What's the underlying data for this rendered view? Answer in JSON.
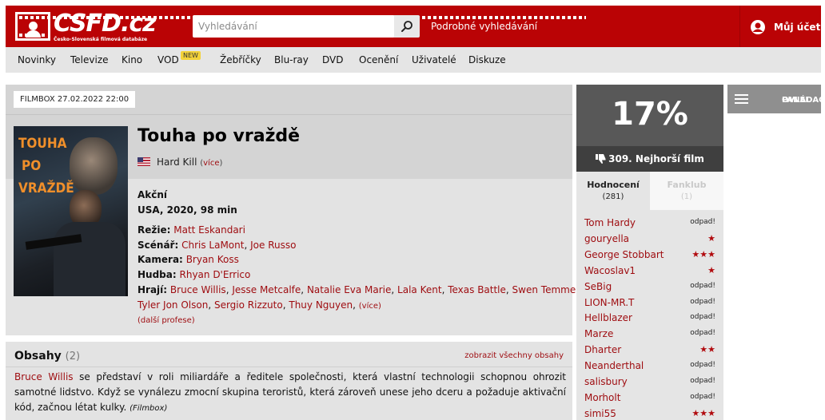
{
  "header": {
    "logo_text": "CSFD.cz",
    "logo_sub": "Česko-Slovenská filmová databáze",
    "search_placeholder": "Vyhledávání",
    "advanced_search": "Podrobné vyhledávání",
    "account": "Můj účet"
  },
  "nav": {
    "items": [
      "Novinky",
      "Televize",
      "Kino",
      "VOD",
      "Žebříčky",
      "Blu-ray",
      "DVD",
      "Ocenění",
      "Uživatelé",
      "Diskuze"
    ],
    "new_badge": "NEW"
  },
  "film": {
    "tv_chip": "FILMBOX 27.02.2022 22:00",
    "poster_text": [
      "TOUHA",
      "PO",
      "VRAŽDĚ"
    ],
    "title": "Touha po vraždě",
    "original_title": "Hard Kill",
    "original_more": "více",
    "genre": "Akční",
    "origin": "USA, 2020, 98 min",
    "directing_label": "Režie:",
    "directing": [
      "Matt Eskandari"
    ],
    "writing_label": "Scénář:",
    "writing": [
      "Chris LaMont",
      "Joe Russo"
    ],
    "camera_label": "Kamera:",
    "camera": [
      "Bryan Koss"
    ],
    "music_label": "Hudba:",
    "music": [
      "Rhyan D'Errico"
    ],
    "cast_label": "Hrají:",
    "cast_line1": [
      "Bruce Willis",
      "Jesse Metcalfe",
      "Natalie Eva Marie",
      "Lala Kent",
      "Texas Battle",
      "Swen Temmel"
    ],
    "cast_line2": [
      "Tyler Jon Olson",
      "Sergio Rizzuto",
      "Thuy Nguyen"
    ],
    "cast_more": "(více)",
    "more_professions": "(další profese)"
  },
  "plots": {
    "title": "Obsahy",
    "count": "(2)",
    "show_all": "zobrazit všechny obsahy",
    "text_link": "Bruce Willis",
    "text_1": " se představí v roli miliardáře a ředitele společnosti, která vlastní technologii schopnou ohrozit samotné lidstvo. Když se vynálezu zmocní skupina teroristů, která zároveň unese jeho dceru a požaduje aktivační kód, začnou létat kulky.",
    "source": "(Filmbox)"
  },
  "rating": {
    "percent": "17%",
    "rank": "309. Nejhorší film",
    "tab_active": "Hodnocení",
    "tab_active_count": "(281)",
    "tab_inactive": "Fanklub",
    "tab_inactive_count": "(1)",
    "users": [
      {
        "name": "Tom Hardy",
        "value": "odpad!",
        "stars": 0
      },
      {
        "name": "gouryella",
        "value": "",
        "stars": 1
      },
      {
        "name": "George Stobbart",
        "value": "",
        "stars": 3
      },
      {
        "name": "Wacoslav1",
        "value": "",
        "stars": 1
      },
      {
        "name": "SeBig",
        "value": "odpad!",
        "stars": 0
      },
      {
        "name": "LION-MR.T",
        "value": "odpad!",
        "stars": 0
      },
      {
        "name": "Hellblazer",
        "value": "odpad!",
        "stars": 0
      },
      {
        "name": "Marze",
        "value": "odpad!",
        "stars": 0
      },
      {
        "name": "Dharter",
        "value": "",
        "stars": 2
      },
      {
        "name": "Neanderthal",
        "value": "odpad!",
        "stars": 0
      },
      {
        "name": "salisbury",
        "value": "odpad!",
        "stars": 0
      },
      {
        "name": "Morholt",
        "value": "odpad!",
        "stars": 0
      },
      {
        "name": "simi55",
        "value": "",
        "stars": 3
      }
    ]
  },
  "panel": {
    "label_line1": "OVLÁDACÍ",
    "label_line2": "PANEL"
  },
  "colors": {
    "brand": "#ba0305",
    "link": "#9e0b0f",
    "rating_bg": "#585858"
  }
}
